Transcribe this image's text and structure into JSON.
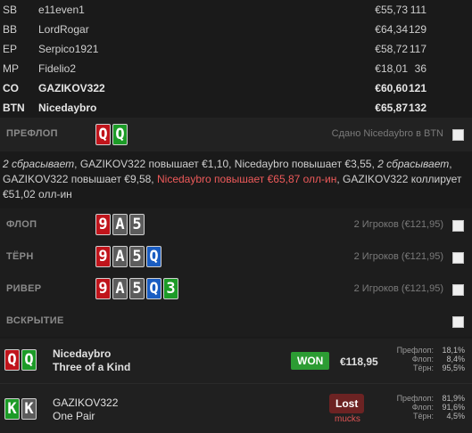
{
  "players": [
    {
      "pos": "SB",
      "name": "e11even1",
      "stack": "€55,73",
      "bb": "111",
      "bold": false
    },
    {
      "pos": "BB",
      "name": "LordRogar",
      "stack": "€64,34",
      "bb": "129",
      "bold": false
    },
    {
      "pos": "EP",
      "name": "Serpico1921",
      "stack": "€58,72",
      "bb": "117",
      "bold": false
    },
    {
      "pos": "MP",
      "name": "Fidelio2",
      "stack": "€18,01",
      "bb": "36",
      "bold": false
    },
    {
      "pos": "CO",
      "name": "GAZIKOV322",
      "stack": "€60,60",
      "bb": "121",
      "bold": true
    },
    {
      "pos": "BTN",
      "name": "Nicedaybro",
      "stack": "€65,87",
      "bb": "132",
      "bold": true
    }
  ],
  "preflop": {
    "title": "ПРЕФЛОП",
    "info": "Сдано Nicedaybro в BTN",
    "cards": [
      {
        "r": "Q",
        "c": "red"
      },
      {
        "r": "Q",
        "c": "green"
      }
    ]
  },
  "actions": {
    "a1": "2 сбрасывает",
    "a2": ", GAZIKOV322 повышает €1,10, Nicedaybro повышает €3,55, ",
    "a3": "2 сбрасывает",
    "a4": ", GAZIKOV322 повышает €9,58, ",
    "a5": "Nicedaybro повышает €65,87 олл-ин",
    "a6": ", GAZIKOV322 коллирует €51,02 олл-ин"
  },
  "flop": {
    "title": "ФЛОП",
    "info": "2 Игроков (€121,95)",
    "cards": [
      {
        "r": "9",
        "c": "red"
      },
      {
        "r": "A",
        "c": "gray"
      },
      {
        "r": "5",
        "c": "gray"
      }
    ]
  },
  "turn": {
    "title": "ТЁРН",
    "info": "2 Игроков (€121,95)",
    "cards": [
      {
        "r": "9",
        "c": "red"
      },
      {
        "r": "A",
        "c": "gray"
      },
      {
        "r": "5",
        "c": "gray"
      },
      {
        "r": "Q",
        "c": "blue"
      }
    ]
  },
  "river": {
    "title": "РИВЕР",
    "info": "2 Игроков (€121,95)",
    "cards": [
      {
        "r": "9",
        "c": "red"
      },
      {
        "r": "A",
        "c": "gray"
      },
      {
        "r": "5",
        "c": "gray"
      },
      {
        "r": "Q",
        "c": "blue"
      },
      {
        "r": "3",
        "c": "green"
      }
    ]
  },
  "showdown": {
    "title": "ВСКРЫТИЕ"
  },
  "results": [
    {
      "name": "Nicedaybro",
      "hand": "Three of a Kind",
      "cards": [
        {
          "r": "Q",
          "c": "red"
        },
        {
          "r": "Q",
          "c": "green"
        }
      ],
      "badge": "WON",
      "amount": "€118,95",
      "stats": [
        {
          "l": "Префлоп:",
          "v": "18,1%"
        },
        {
          "l": "Флоп:",
          "v": "8,4%"
        },
        {
          "l": "Тёрн:",
          "v": "95,5%"
        }
      ]
    },
    {
      "name": "GAZIKOV322",
      "hand": "One Pair",
      "cards": [
        {
          "r": "K",
          "c": "green"
        },
        {
          "r": "K",
          "c": "gray"
        }
      ],
      "badge": "Lost",
      "sub": "mucks",
      "stats": [
        {
          "l": "Префлоп:",
          "v": "81,9%"
        },
        {
          "l": "Флоп:",
          "v": "91,6%"
        },
        {
          "l": "Тёрн:",
          "v": "4,5%"
        }
      ]
    }
  ]
}
